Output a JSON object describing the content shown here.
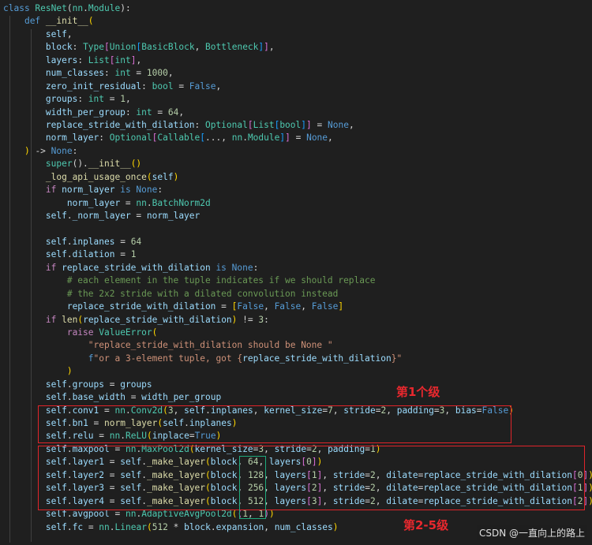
{
  "code_lines": [
    [
      [
        "class ",
        "kw"
      ],
      [
        "ResNet",
        "cls"
      ],
      [
        "(",
        "pl"
      ],
      [
        "nn",
        "cls"
      ],
      [
        ".",
        "pl"
      ],
      [
        "Module",
        "cls"
      ],
      [
        "):",
        "pl"
      ]
    ],
    [
      [
        "    ",
        "pl"
      ],
      [
        "def ",
        "kw"
      ],
      [
        "__init__",
        "fn"
      ],
      [
        "(",
        "bk"
      ]
    ],
    [
      [
        "        ",
        "pl"
      ],
      [
        "self",
        "var"
      ],
      [
        ",",
        "pl"
      ]
    ],
    [
      [
        "        ",
        "pl"
      ],
      [
        "block",
        "var"
      ],
      [
        ": ",
        "pl"
      ],
      [
        "Type",
        "cls"
      ],
      [
        "[",
        "br2"
      ],
      [
        "Union",
        "cls"
      ],
      [
        "[",
        "br3"
      ],
      [
        "BasicBlock",
        "cls"
      ],
      [
        ", ",
        "pl"
      ],
      [
        "Bottleneck",
        "cls"
      ],
      [
        "]",
        "br3"
      ],
      [
        "]",
        "br2"
      ],
      [
        ",",
        "pl"
      ]
    ],
    [
      [
        "        ",
        "pl"
      ],
      [
        "layers",
        "var"
      ],
      [
        ": ",
        "pl"
      ],
      [
        "List",
        "cls"
      ],
      [
        "[",
        "br2"
      ],
      [
        "int",
        "cls"
      ],
      [
        "]",
        "br2"
      ],
      [
        ",",
        "pl"
      ]
    ],
    [
      [
        "        ",
        "pl"
      ],
      [
        "num_classes",
        "var"
      ],
      [
        ": ",
        "pl"
      ],
      [
        "int",
        "cls"
      ],
      [
        " = ",
        "pl"
      ],
      [
        "1000",
        "num"
      ],
      [
        ",",
        "pl"
      ]
    ],
    [
      [
        "        ",
        "pl"
      ],
      [
        "zero_init_residual",
        "var"
      ],
      [
        ": ",
        "pl"
      ],
      [
        "bool",
        "cls"
      ],
      [
        " = ",
        "pl"
      ],
      [
        "False",
        "kw"
      ],
      [
        ",",
        "pl"
      ]
    ],
    [
      [
        "        ",
        "pl"
      ],
      [
        "groups",
        "var"
      ],
      [
        ": ",
        "pl"
      ],
      [
        "int",
        "cls"
      ],
      [
        " = ",
        "pl"
      ],
      [
        "1",
        "num"
      ],
      [
        ",",
        "pl"
      ]
    ],
    [
      [
        "        ",
        "pl"
      ],
      [
        "width_per_group",
        "var"
      ],
      [
        ": ",
        "pl"
      ],
      [
        "int",
        "cls"
      ],
      [
        " = ",
        "pl"
      ],
      [
        "64",
        "num"
      ],
      [
        ",",
        "pl"
      ]
    ],
    [
      [
        "        ",
        "pl"
      ],
      [
        "replace_stride_with_dilation",
        "var"
      ],
      [
        ": ",
        "pl"
      ],
      [
        "Optional",
        "cls"
      ],
      [
        "[",
        "br2"
      ],
      [
        "List",
        "cls"
      ],
      [
        "[",
        "br3"
      ],
      [
        "bool",
        "cls"
      ],
      [
        "]",
        "br3"
      ],
      [
        "]",
        "br2"
      ],
      [
        " = ",
        "pl"
      ],
      [
        "None",
        "kw"
      ],
      [
        ",",
        "pl"
      ]
    ],
    [
      [
        "        ",
        "pl"
      ],
      [
        "norm_layer",
        "var"
      ],
      [
        ": ",
        "pl"
      ],
      [
        "Optional",
        "cls"
      ],
      [
        "[",
        "br2"
      ],
      [
        "Callable",
        "cls"
      ],
      [
        "[",
        "br3"
      ],
      [
        "..., ",
        "pl"
      ],
      [
        "nn",
        "cls"
      ],
      [
        ".",
        "pl"
      ],
      [
        "Module",
        "cls"
      ],
      [
        "]",
        "br3"
      ],
      [
        "]",
        "br2"
      ],
      [
        " = ",
        "pl"
      ],
      [
        "None",
        "kw"
      ],
      [
        ",",
        "pl"
      ]
    ],
    [
      [
        "    ",
        "pl"
      ],
      [
        ")",
        "bk"
      ],
      [
        " -> ",
        "pl"
      ],
      [
        "None",
        "kw"
      ],
      [
        ":",
        "pl"
      ]
    ],
    [
      [
        "        ",
        "pl"
      ],
      [
        "super",
        "cls"
      ],
      [
        "().",
        "pl"
      ],
      [
        "__init__",
        "fn"
      ],
      [
        "()",
        "bk"
      ]
    ],
    [
      [
        "        ",
        "pl"
      ],
      [
        "_log_api_usage_once",
        "fn"
      ],
      [
        "(",
        "bk"
      ],
      [
        "self",
        "var"
      ],
      [
        ")",
        "bk"
      ]
    ],
    [
      [
        "        ",
        "pl"
      ],
      [
        "if ",
        "ctl"
      ],
      [
        "norm_layer",
        "var"
      ],
      [
        " is ",
        "kw"
      ],
      [
        "None",
        "kw"
      ],
      [
        ":",
        "pl"
      ]
    ],
    [
      [
        "            ",
        "pl"
      ],
      [
        "norm_layer",
        "var"
      ],
      [
        " = ",
        "pl"
      ],
      [
        "nn",
        "cls"
      ],
      [
        ".",
        "pl"
      ],
      [
        "BatchNorm2d",
        "cls"
      ]
    ],
    [
      [
        "        ",
        "pl"
      ],
      [
        "self",
        "var"
      ],
      [
        ".",
        "pl"
      ],
      [
        "_norm_layer",
        "var"
      ],
      [
        " = ",
        "pl"
      ],
      [
        "norm_layer",
        "var"
      ]
    ],
    [
      [
        "",
        "pl"
      ]
    ],
    [
      [
        "        ",
        "pl"
      ],
      [
        "self",
        "var"
      ],
      [
        ".",
        "pl"
      ],
      [
        "inplanes",
        "var"
      ],
      [
        " = ",
        "pl"
      ],
      [
        "64",
        "num"
      ]
    ],
    [
      [
        "        ",
        "pl"
      ],
      [
        "self",
        "var"
      ],
      [
        ".",
        "pl"
      ],
      [
        "dilation",
        "var"
      ],
      [
        " = ",
        "pl"
      ],
      [
        "1",
        "num"
      ]
    ],
    [
      [
        "        ",
        "pl"
      ],
      [
        "if ",
        "ctl"
      ],
      [
        "replace_stride_with_dilation",
        "var"
      ],
      [
        " is ",
        "kw"
      ],
      [
        "None",
        "kw"
      ],
      [
        ":",
        "pl"
      ]
    ],
    [
      [
        "            ",
        "pl"
      ],
      [
        "# each element in the tuple indicates if we should replace",
        "cmt"
      ]
    ],
    [
      [
        "            ",
        "pl"
      ],
      [
        "# the 2x2 stride with a dilated convolution instead",
        "cmt"
      ]
    ],
    [
      [
        "            ",
        "pl"
      ],
      [
        "replace_stride_with_dilation",
        "var"
      ],
      [
        " = ",
        "pl"
      ],
      [
        "[",
        "bk"
      ],
      [
        "False",
        "kw"
      ],
      [
        ", ",
        "pl"
      ],
      [
        "False",
        "kw"
      ],
      [
        ", ",
        "pl"
      ],
      [
        "False",
        "kw"
      ],
      [
        "]",
        "bk"
      ]
    ],
    [
      [
        "        ",
        "pl"
      ],
      [
        "if ",
        "ctl"
      ],
      [
        "len",
        "fn"
      ],
      [
        "(",
        "bk"
      ],
      [
        "replace_stride_with_dilation",
        "var"
      ],
      [
        ")",
        "bk"
      ],
      [
        " != ",
        "pl"
      ],
      [
        "3",
        "num"
      ],
      [
        ":",
        "pl"
      ]
    ],
    [
      [
        "            ",
        "pl"
      ],
      [
        "raise ",
        "ctl"
      ],
      [
        "ValueError",
        "cls"
      ],
      [
        "(",
        "bk"
      ]
    ],
    [
      [
        "                ",
        "pl"
      ],
      [
        "\"replace_stride_with_dilation should be None \"",
        "str"
      ]
    ],
    [
      [
        "                ",
        "pl"
      ],
      [
        "f",
        "kw"
      ],
      [
        "\"or a 3-element tuple, got {",
        "str"
      ],
      [
        "replace_stride_with_dilation",
        "var"
      ],
      [
        "}\"",
        "str"
      ]
    ],
    [
      [
        "            ",
        "pl"
      ],
      [
        ")",
        "bk"
      ]
    ],
    [
      [
        "        ",
        "pl"
      ],
      [
        "self",
        "var"
      ],
      [
        ".",
        "pl"
      ],
      [
        "groups",
        "var"
      ],
      [
        " = ",
        "pl"
      ],
      [
        "groups",
        "var"
      ]
    ],
    [
      [
        "        ",
        "pl"
      ],
      [
        "self",
        "var"
      ],
      [
        ".",
        "pl"
      ],
      [
        "base_width",
        "var"
      ],
      [
        " = ",
        "pl"
      ],
      [
        "width_per_group",
        "var"
      ]
    ],
    [
      [
        "        ",
        "pl"
      ],
      [
        "self",
        "var"
      ],
      [
        ".",
        "pl"
      ],
      [
        "conv1",
        "var"
      ],
      [
        " = ",
        "pl"
      ],
      [
        "nn",
        "cls"
      ],
      [
        ".",
        "pl"
      ],
      [
        "Conv2d",
        "cls"
      ],
      [
        "(",
        "bk"
      ],
      [
        "3",
        "num"
      ],
      [
        ", ",
        "pl"
      ],
      [
        "self",
        "var"
      ],
      [
        ".",
        "pl"
      ],
      [
        "inplanes",
        "var"
      ],
      [
        ", ",
        "pl"
      ],
      [
        "kernel_size",
        "var"
      ],
      [
        "=",
        "pl"
      ],
      [
        "7",
        "num"
      ],
      [
        ", ",
        "pl"
      ],
      [
        "stride",
        "var"
      ],
      [
        "=",
        "pl"
      ],
      [
        "2",
        "num"
      ],
      [
        ", ",
        "pl"
      ],
      [
        "padding",
        "var"
      ],
      [
        "=",
        "pl"
      ],
      [
        "3",
        "num"
      ],
      [
        ", ",
        "pl"
      ],
      [
        "bias",
        "var"
      ],
      [
        "=",
        "pl"
      ],
      [
        "False",
        "kw"
      ],
      [
        ")",
        "bk"
      ]
    ],
    [
      [
        "        ",
        "pl"
      ],
      [
        "self",
        "var"
      ],
      [
        ".",
        "pl"
      ],
      [
        "bn1",
        "var"
      ],
      [
        " = ",
        "pl"
      ],
      [
        "norm_layer",
        "fn"
      ],
      [
        "(",
        "bk"
      ],
      [
        "self",
        "var"
      ],
      [
        ".",
        "pl"
      ],
      [
        "inplanes",
        "var"
      ],
      [
        ")",
        "bk"
      ]
    ],
    [
      [
        "        ",
        "pl"
      ],
      [
        "self",
        "var"
      ],
      [
        ".",
        "pl"
      ],
      [
        "relu",
        "var"
      ],
      [
        " = ",
        "pl"
      ],
      [
        "nn",
        "cls"
      ],
      [
        ".",
        "pl"
      ],
      [
        "ReLU",
        "cls"
      ],
      [
        "(",
        "bk"
      ],
      [
        "inplace",
        "var"
      ],
      [
        "=",
        "pl"
      ],
      [
        "True",
        "kw"
      ],
      [
        ")",
        "bk"
      ]
    ],
    [
      [
        "        ",
        "pl"
      ],
      [
        "self",
        "var"
      ],
      [
        ".",
        "pl"
      ],
      [
        "maxpool",
        "var"
      ],
      [
        " = ",
        "pl"
      ],
      [
        "nn",
        "cls"
      ],
      [
        ".",
        "pl"
      ],
      [
        "MaxPool2d",
        "cls"
      ],
      [
        "(",
        "bk"
      ],
      [
        "kernel_size",
        "var"
      ],
      [
        "=",
        "pl"
      ],
      [
        "3",
        "num"
      ],
      [
        ", ",
        "pl"
      ],
      [
        "stride",
        "var"
      ],
      [
        "=",
        "pl"
      ],
      [
        "2",
        "num"
      ],
      [
        ", ",
        "pl"
      ],
      [
        "padding",
        "var"
      ],
      [
        "=",
        "pl"
      ],
      [
        "1",
        "num"
      ],
      [
        ")",
        "bk"
      ]
    ],
    [
      [
        "        ",
        "pl"
      ],
      [
        "self",
        "var"
      ],
      [
        ".",
        "pl"
      ],
      [
        "layer1",
        "var"
      ],
      [
        " = ",
        "pl"
      ],
      [
        "self",
        "var"
      ],
      [
        ".",
        "pl"
      ],
      [
        "_make_layer",
        "fn"
      ],
      [
        "(",
        "bk"
      ],
      [
        "block",
        "var"
      ],
      [
        ", ",
        "pl"
      ],
      [
        "64",
        "num"
      ],
      [
        ", ",
        "pl"
      ],
      [
        "layers",
        "var"
      ],
      [
        "[",
        "br2"
      ],
      [
        "0",
        "num"
      ],
      [
        "]",
        "br2"
      ],
      [
        ")",
        "bk"
      ]
    ],
    [
      [
        "        ",
        "pl"
      ],
      [
        "self",
        "var"
      ],
      [
        ".",
        "pl"
      ],
      [
        "layer2",
        "var"
      ],
      [
        " = ",
        "pl"
      ],
      [
        "self",
        "var"
      ],
      [
        ".",
        "pl"
      ],
      [
        "_make_layer",
        "fn"
      ],
      [
        "(",
        "bk"
      ],
      [
        "block",
        "var"
      ],
      [
        ", ",
        "pl"
      ],
      [
        "128",
        "num"
      ],
      [
        ", ",
        "pl"
      ],
      [
        "layers",
        "var"
      ],
      [
        "[",
        "br2"
      ],
      [
        "1",
        "num"
      ],
      [
        "]",
        "br2"
      ],
      [
        ", ",
        "pl"
      ],
      [
        "stride",
        "var"
      ],
      [
        "=",
        "pl"
      ],
      [
        "2",
        "num"
      ],
      [
        ", ",
        "pl"
      ],
      [
        "dilate",
        "var"
      ],
      [
        "=",
        "pl"
      ],
      [
        "replace_stride_with_dilation",
        "var"
      ],
      [
        "[",
        "br2"
      ],
      [
        "0",
        "num"
      ],
      [
        "]",
        "br2"
      ],
      [
        ")",
        "bk"
      ]
    ],
    [
      [
        "        ",
        "pl"
      ],
      [
        "self",
        "var"
      ],
      [
        ".",
        "pl"
      ],
      [
        "layer3",
        "var"
      ],
      [
        " = ",
        "pl"
      ],
      [
        "self",
        "var"
      ],
      [
        ".",
        "pl"
      ],
      [
        "_make_layer",
        "fn"
      ],
      [
        "(",
        "bk"
      ],
      [
        "block",
        "var"
      ],
      [
        ", ",
        "pl"
      ],
      [
        "256",
        "num"
      ],
      [
        ", ",
        "pl"
      ],
      [
        "layers",
        "var"
      ],
      [
        "[",
        "br2"
      ],
      [
        "2",
        "num"
      ],
      [
        "]",
        "br2"
      ],
      [
        ", ",
        "pl"
      ],
      [
        "stride",
        "var"
      ],
      [
        "=",
        "pl"
      ],
      [
        "2",
        "num"
      ],
      [
        ", ",
        "pl"
      ],
      [
        "dilate",
        "var"
      ],
      [
        "=",
        "pl"
      ],
      [
        "replace_stride_with_dilation",
        "var"
      ],
      [
        "[",
        "br2"
      ],
      [
        "1",
        "num"
      ],
      [
        "]",
        "br2"
      ],
      [
        ")",
        "bk"
      ]
    ],
    [
      [
        "        ",
        "pl"
      ],
      [
        "self",
        "var"
      ],
      [
        ".",
        "pl"
      ],
      [
        "layer4",
        "var"
      ],
      [
        " = ",
        "pl"
      ],
      [
        "self",
        "var"
      ],
      [
        ".",
        "pl"
      ],
      [
        "_make_layer",
        "fn"
      ],
      [
        "(",
        "bk"
      ],
      [
        "block",
        "var"
      ],
      [
        ", ",
        "pl"
      ],
      [
        "512",
        "num"
      ],
      [
        ", ",
        "pl"
      ],
      [
        "layers",
        "var"
      ],
      [
        "[",
        "br2"
      ],
      [
        "3",
        "num"
      ],
      [
        "]",
        "br2"
      ],
      [
        ", ",
        "pl"
      ],
      [
        "stride",
        "var"
      ],
      [
        "=",
        "pl"
      ],
      [
        "2",
        "num"
      ],
      [
        ", ",
        "pl"
      ],
      [
        "dilate",
        "var"
      ],
      [
        "=",
        "pl"
      ],
      [
        "replace_stride_with_dilation",
        "var"
      ],
      [
        "[",
        "br2"
      ],
      [
        "2",
        "num"
      ],
      [
        "]",
        "br2"
      ],
      [
        ")",
        "bk"
      ]
    ],
    [
      [
        "        ",
        "pl"
      ],
      [
        "self",
        "var"
      ],
      [
        ".",
        "pl"
      ],
      [
        "avgpool",
        "var"
      ],
      [
        " = ",
        "pl"
      ],
      [
        "nn",
        "cls"
      ],
      [
        ".",
        "pl"
      ],
      [
        "AdaptiveAvgPool2d",
        "cls"
      ],
      [
        "(",
        "bk"
      ],
      [
        "(",
        "br2"
      ],
      [
        "1",
        "num"
      ],
      [
        ", ",
        "pl"
      ],
      [
        "1",
        "num"
      ],
      [
        ")",
        "br2"
      ],
      [
        ")",
        "bk"
      ]
    ],
    [
      [
        "        ",
        "pl"
      ],
      [
        "self",
        "var"
      ],
      [
        ".",
        "pl"
      ],
      [
        "fc",
        "var"
      ],
      [
        " = ",
        "pl"
      ],
      [
        "nn",
        "cls"
      ],
      [
        ".",
        "pl"
      ],
      [
        "Linear",
        "cls"
      ],
      [
        "(",
        "bk"
      ],
      [
        "512",
        "num"
      ],
      [
        " * ",
        "pl"
      ],
      [
        "block",
        "var"
      ],
      [
        ".",
        "pl"
      ],
      [
        "expansion",
        "var"
      ],
      [
        ", ",
        "pl"
      ],
      [
        "num_classes",
        "var"
      ],
      [
        ")",
        "bk"
      ]
    ]
  ],
  "annotations": {
    "stage1_label": "第1个级",
    "stage2_5_label": "第2-5级"
  },
  "watermark": "CSDN @一直向上的路上",
  "colors": {
    "background": "#1f1f1f",
    "highlight_box": "#e0242a",
    "channel_box": "#1ea97c",
    "annotation_text": "#e8282e"
  }
}
